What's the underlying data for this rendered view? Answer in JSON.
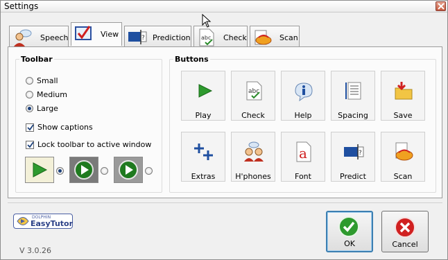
{
  "window": {
    "title": "Settings"
  },
  "tabs": [
    {
      "label": "Speech",
      "icon": "speech-person-icon"
    },
    {
      "label": "View",
      "icon": "view-check-icon"
    },
    {
      "label": "Prediction",
      "icon": "prediction-icon"
    },
    {
      "label": "Check",
      "icon": "spell-check-icon"
    },
    {
      "label": "Scan",
      "icon": "scan-icon"
    }
  ],
  "active_tab": "View",
  "toolbar": {
    "title": "Toolbar",
    "sizes": [
      {
        "label": "Small",
        "selected": false
      },
      {
        "label": "Medium",
        "selected": false
      },
      {
        "label": "Large",
        "selected": true
      }
    ],
    "show_captions": {
      "label": "Show captions",
      "checked": true
    },
    "lock_toolbar": {
      "label": "Lock toolbar to active window",
      "checked": true
    },
    "styles": [
      {
        "name": "play-light-style",
        "selected": true
      },
      {
        "name": "play-dark-style",
        "selected": false
      },
      {
        "name": "play-dark-round-style",
        "selected": false
      }
    ]
  },
  "buttons": {
    "title": "Buttons",
    "items": [
      {
        "label": "Play",
        "icon": "play-icon"
      },
      {
        "label": "Check",
        "icon": "check-document-icon"
      },
      {
        "label": "Help",
        "icon": "help-info-icon"
      },
      {
        "label": "Spacing",
        "icon": "spacing-icon"
      },
      {
        "label": "Save",
        "icon": "save-folder-icon"
      },
      {
        "label": "Extras",
        "icon": "extras-plus-icon"
      },
      {
        "label": "H'phones",
        "icon": "headphones-people-icon"
      },
      {
        "label": "Font",
        "icon": "font-icon"
      },
      {
        "label": "Predict",
        "icon": "predict-icon"
      },
      {
        "label": "Scan",
        "icon": "scan-icon"
      }
    ]
  },
  "logo": {
    "small_text": "DOLPHIN",
    "main_text": "EasyTutor"
  },
  "version": "V 3.0.26",
  "actions": {
    "ok": "OK",
    "cancel": "Cancel"
  },
  "colors": {
    "accent_green": "#2e9a2e",
    "cancel_red": "#d02020",
    "panel_bg": "#fbfbfb"
  }
}
